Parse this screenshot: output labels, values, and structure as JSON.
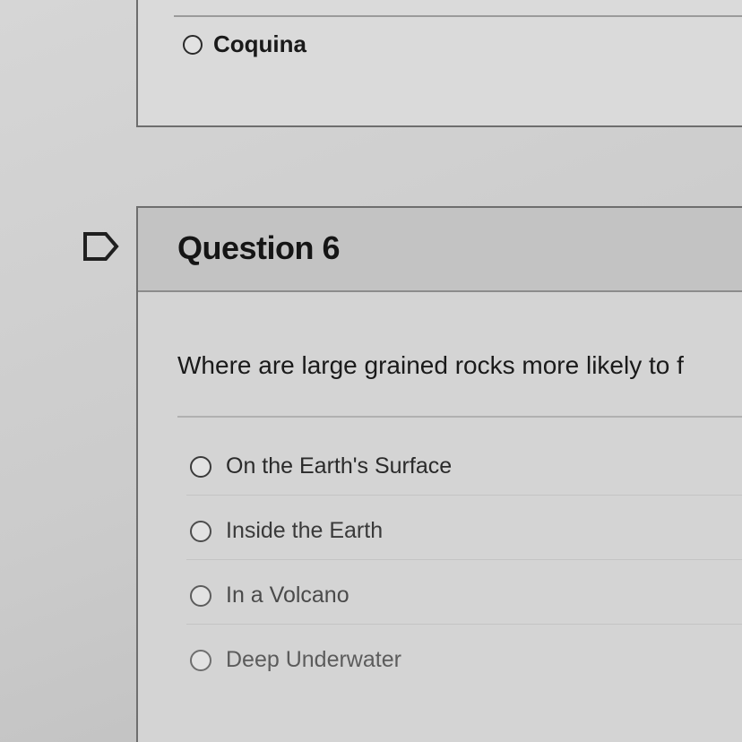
{
  "previous_question": {
    "last_option_label": "Coquina"
  },
  "question": {
    "title": "Question 6",
    "text": "Where are large grained rocks more likely to f",
    "options": [
      {
        "label": "On the Earth's Surface"
      },
      {
        "label": "Inside the Earth"
      },
      {
        "label": "In a Volcano"
      },
      {
        "label": "Deep Underwater"
      }
    ]
  },
  "icons": {
    "flag": "flag-icon",
    "radio": "radio-unselected-icon"
  },
  "colors": {
    "background": "#cfcfcf",
    "header": "#c3c3c3",
    "border": "#6e6e6e",
    "text": "#1c1c1c"
  }
}
